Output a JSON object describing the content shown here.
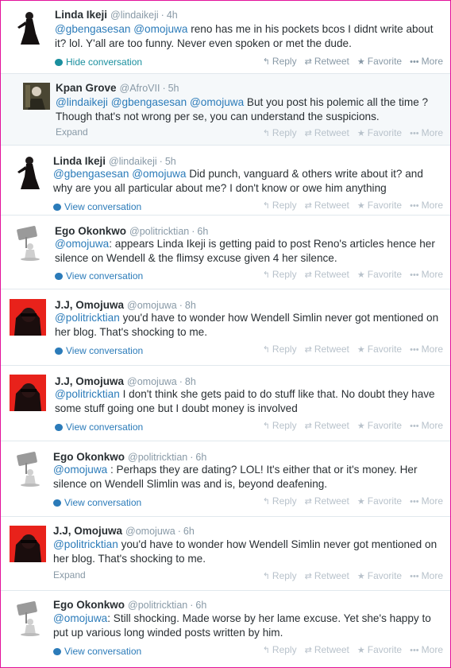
{
  "actions": {
    "reply": "Reply",
    "retweet": "Retweet",
    "favorite": "Favorite",
    "more": "More"
  },
  "icons": {
    "reply": "reply-arrow-icon",
    "retweet": "retweet-icon",
    "favorite": "star-icon",
    "more": "more-dots-icon",
    "conversation": "speech-bubble-icon"
  },
  "colors": {
    "frame_border": "#e2119a",
    "link": "#2b7bb9",
    "muted": "#8899a6",
    "reply_bg": "#f5f8fa"
  },
  "tweets": [
    {
      "name": "Linda Ikeji",
      "handle": "@lindaikeji",
      "time": "4h",
      "line1": [
        {
          "t": "@gbengasesan",
          "m": true
        },
        {
          "t": " "
        },
        {
          "t": "@omojuwa",
          "m": true
        },
        {
          "t": " reno has me in his pockets bcos I didnt write about"
        }
      ],
      "line2": [
        {
          "t": "it? lol. Y'all are too funny. Never even spoken or met the dude."
        }
      ],
      "footer": "Hide conversation"
    },
    {
      "name": "Kpan Grove",
      "handle": "@AfroVII",
      "time": "5h",
      "line1": [
        {
          "t": "@lindaikeji",
          "m": true
        },
        {
          "t": " "
        },
        {
          "t": "@gbengasesan",
          "m": true
        },
        {
          "t": " "
        },
        {
          "t": "@omojuwa",
          "m": true
        },
        {
          "t": " But you post his polemic all the time ?"
        }
      ],
      "line2": [
        {
          "t": "Though that's not wrong per se, you can understand the suspicions."
        }
      ],
      "footer": "Expand"
    },
    {
      "name": "Linda Ikeji",
      "handle": "@lindaikeji",
      "time": "5h",
      "line1": [
        {
          "t": "@gbengasesan",
          "m": true
        },
        {
          "t": " "
        },
        {
          "t": "@omojuwa",
          "m": true
        },
        {
          "t": " Did punch, vanguard & others write about it? and"
        }
      ],
      "line2": [
        {
          "t": "why are you all particular about me? I don't know or owe him anything"
        }
      ],
      "footer": "View conversation"
    },
    {
      "name": "Ego Okonkwo",
      "handle": "@politricktian",
      "time": "6h",
      "line1": [
        {
          "t": "@omojuwa",
          "m": true
        },
        {
          "t": ": appears Linda Ikeji is getting paid to post Reno's articles hence her"
        }
      ],
      "line2": [
        {
          "t": "silence on Wendell & the flimsy excuse given 4 her silence."
        }
      ],
      "footer": "View conversation"
    },
    {
      "name": "J.J, Omojuwa",
      "handle": "@omojuwa",
      "time": "8h",
      "line1": [
        {
          "t": "@politricktian",
          "m": true
        },
        {
          "t": " you'd have to wonder how Wendell Simlin never got mentioned on"
        }
      ],
      "line2": [
        {
          "t": "her blog. That's shocking to me."
        }
      ],
      "footer": "View conversation"
    },
    {
      "name": "J.J, Omojuwa",
      "handle": "@omojuwa",
      "time": "8h",
      "line1": [
        {
          "t": "@politricktian",
          "m": true
        },
        {
          "t": " I don't think she gets paid to do stuff like that. No doubt they have"
        }
      ],
      "line2": [
        {
          "t": "some stuff going one but I doubt money is involved"
        }
      ],
      "footer": "View conversation"
    },
    {
      "name": "Ego Okonkwo",
      "handle": "@politricktian",
      "time": "6h",
      "line1": [
        {
          "t": "@omojuwa",
          "m": true
        },
        {
          "t": " : Perhaps they are dating? LOL! It's either that or it's money. Her"
        }
      ],
      "line2": [
        {
          "t": "silence on Wendell Slimlin was and is, beyond deafening."
        }
      ],
      "footer": "View conversation"
    },
    {
      "name": "J.J, Omojuwa",
      "handle": "@omojuwa",
      "time": "6h",
      "line1": [
        {
          "t": "@politricktian",
          "m": true
        },
        {
          "t": " you'd have to wonder how Wendell Simlin never got mentioned on"
        }
      ],
      "line2": [
        {
          "t": "her blog. That's shocking to me."
        }
      ],
      "footer": "Expand"
    },
    {
      "name": "Ego Okonkwo",
      "handle": "@politricktian",
      "time": "6h",
      "line1": [
        {
          "t": "@omojuwa",
          "m": true
        },
        {
          "t": ": Still shocking. Made worse by her lame excuse. Yet she's happy to"
        }
      ],
      "line2": [
        {
          "t": "put up various long winded posts written by him."
        }
      ],
      "footer": "View conversation"
    }
  ]
}
